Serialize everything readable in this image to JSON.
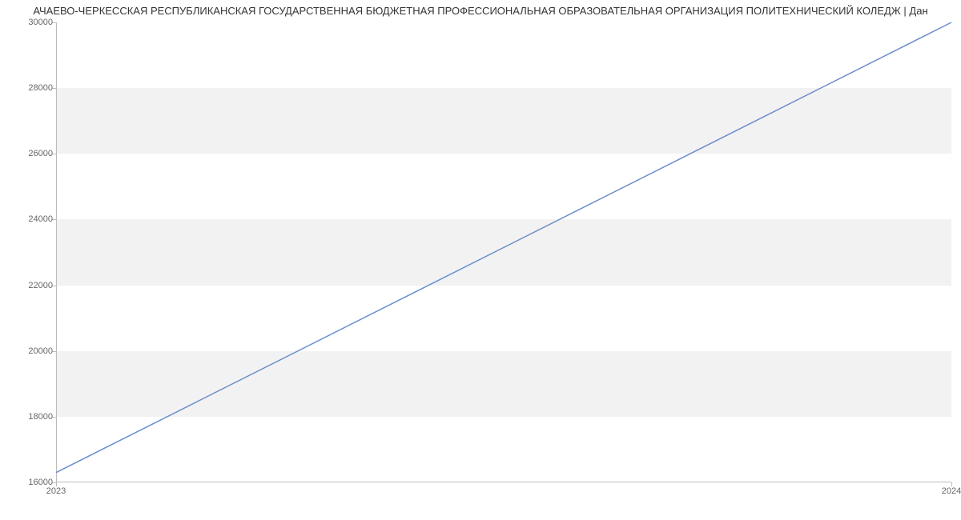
{
  "chart_data": {
    "type": "line",
    "title": "АЧАЕВО-ЧЕРКЕССКАЯ РЕСПУБЛИКАНСКАЯ ГОСУДАРСТВЕННАЯ БЮДЖЕТНАЯ ПРОФЕССИОНАЛЬНАЯ ОБРАЗОВАТЕЛЬНАЯ ОРГАНИЗАЦИЯ ПОЛИТЕХНИЧЕСКИЙ КОЛЕДЖ | Дан",
    "x": [
      2023,
      2024
    ],
    "values": [
      16300,
      30000
    ],
    "xlabel": "",
    "ylabel": "",
    "ylim": [
      16000,
      30000
    ],
    "xlim": [
      2023,
      2024
    ],
    "y_ticks": [
      16000,
      18000,
      20000,
      22000,
      24000,
      26000,
      28000,
      30000
    ],
    "x_ticks": [
      2023,
      2024
    ]
  }
}
